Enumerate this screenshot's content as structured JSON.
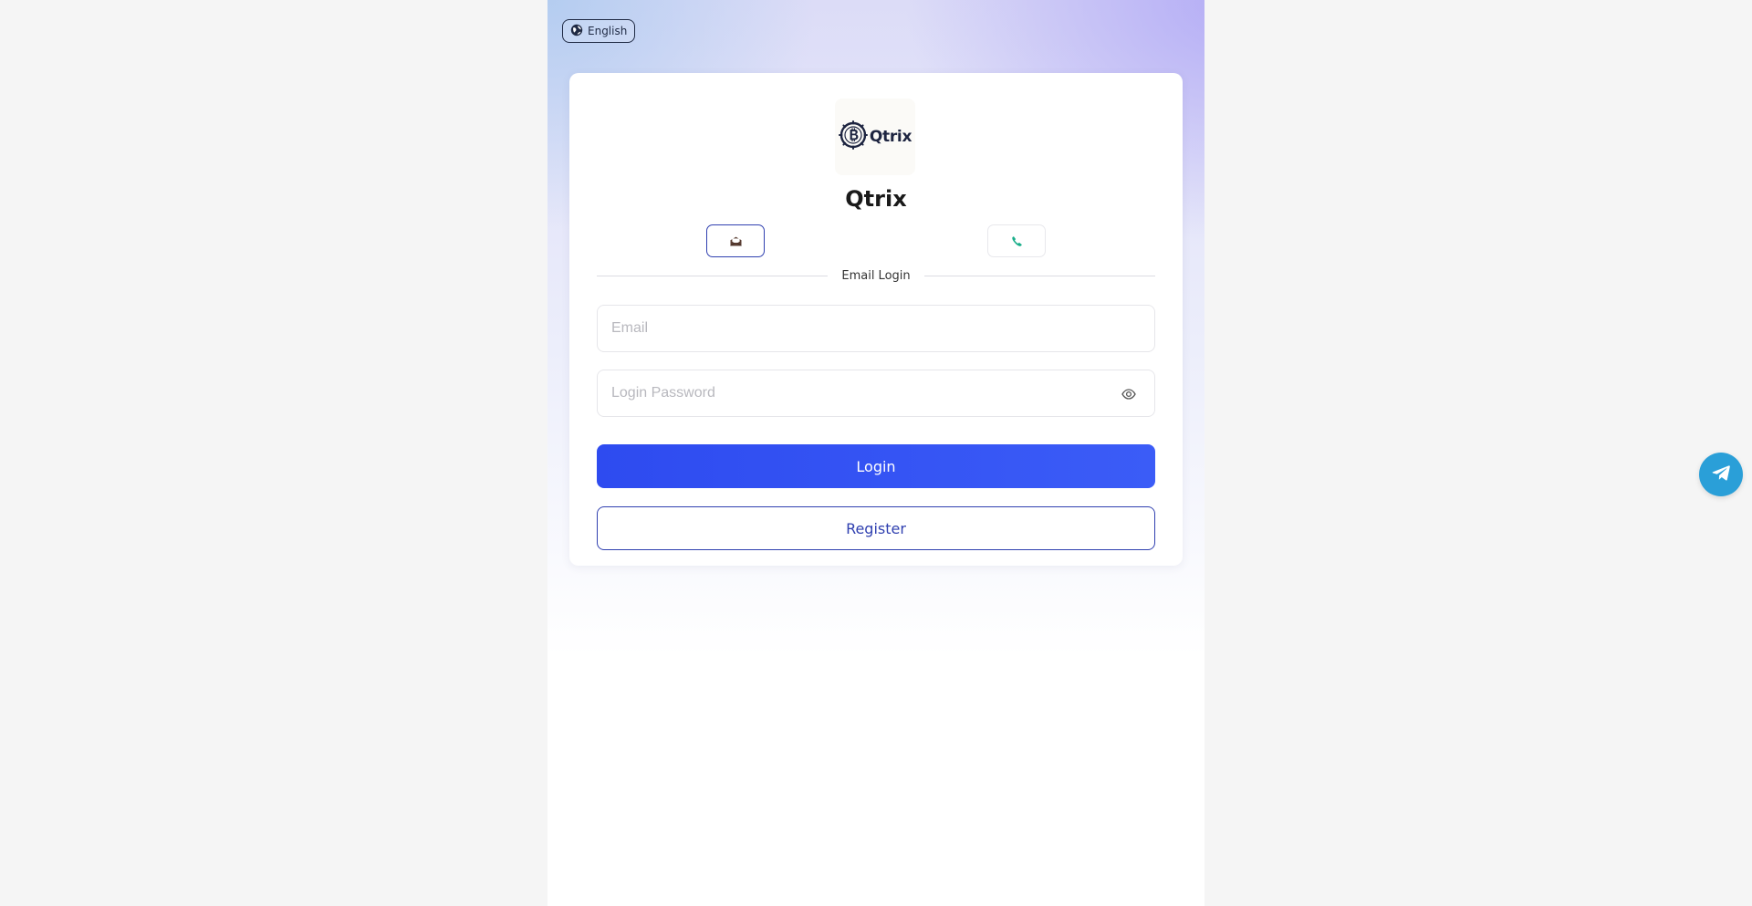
{
  "language": {
    "label": "English",
    "icon": "language-icon"
  },
  "brand": {
    "logo_text": "Qtrix",
    "logo_icon": "bitcoin-gear-icon",
    "title": "Qtrix"
  },
  "login_methods": [
    {
      "id": "email",
      "icon": "email-icon",
      "active": true
    },
    {
      "id": "phone",
      "icon": "phone-icon",
      "active": false
    }
  ],
  "form": {
    "section_label": "Email Login",
    "email_placeholder": "Email",
    "password_placeholder": "Login Password",
    "password_toggle_icon": "eye-icon"
  },
  "actions": {
    "login_label": "Login",
    "register_label": "Register"
  },
  "support": {
    "icon": "telegram-icon"
  },
  "colors": {
    "primary": "#3048F2",
    "outline": "#3040B0",
    "telegram": "#2A9FD8",
    "phone_icon": "#1AAE8A",
    "page_background": "#F5F5F5"
  }
}
